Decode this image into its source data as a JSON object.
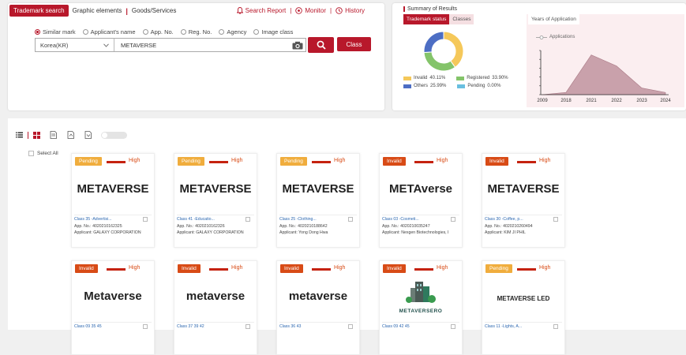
{
  "search": {
    "tabs": {
      "active": "Trademark search",
      "graphic": "Graphic elements",
      "goods": "Goods/Services"
    },
    "links": {
      "report": "Search Report",
      "monitor": "Monitor",
      "history": "History"
    },
    "options": [
      "Similar mark",
      "Applicant's name",
      "App. No.",
      "Reg. No.",
      "Agency",
      "Image class"
    ],
    "country": "Korea(KR)",
    "query": "METAVERSE",
    "class_btn": "Class"
  },
  "summary": {
    "title": "Summary of Results",
    "tabs": {
      "status": "Trademark status",
      "classes": "Classes"
    },
    "legend": [
      {
        "label": "Invalid",
        "pct": "40.11%",
        "color": "#f5c85a"
      },
      {
        "label": "Registered",
        "pct": "33.90%",
        "color": "#84c46a"
      },
      {
        "label": "Others",
        "pct": "25.99%",
        "color": "#4d6ec4"
      },
      {
        "label": "Pending",
        "pct": "0.00%",
        "color": "#69bfe0"
      }
    ],
    "yoa_label": "Years of Application",
    "series_name": "Applications",
    "years": [
      "2009",
      "2018",
      "2021",
      "2022",
      "2023",
      "2024"
    ]
  },
  "chart_data": [
    {
      "type": "pie",
      "categories": [
        "Invalid",
        "Registered",
        "Others",
        "Pending"
      ],
      "values": [
        40.11,
        33.9,
        25.99,
        0.0
      ]
    },
    {
      "type": "area",
      "series": [
        {
          "name": "Applications",
          "values": [
            0,
            1,
            18,
            13,
            3,
            1
          ]
        }
      ],
      "categories": [
        "2009",
        "2018",
        "2021",
        "2022",
        "2023",
        "2024"
      ],
      "ylim": [
        0,
        20
      ]
    }
  ],
  "results": {
    "select_all": "Select All",
    "similarity": "High",
    "cards": [
      {
        "status": "Pending",
        "mark": "METAVERSE",
        "cls": "Class 35 -Advertisi...",
        "app": "App. No.: 4020210162325",
        "applicant": "Applicant: GALAXY CORPORATION"
      },
      {
        "status": "Pending",
        "mark": "METAVERSE",
        "cls": "Class 41 -Educatio...",
        "app": "App. No.: 4020210162326",
        "applicant": "Applicant: GALAXY CORPORATION"
      },
      {
        "status": "Pending",
        "mark": "METAVERSE",
        "cls": "Class 25 -Clothing...",
        "app": "App. No.: 4020210188642",
        "applicant": "Applicant: Yong Dong Hwa"
      },
      {
        "status": "Invalid",
        "mark": "METAverse",
        "cls": "Class 03 -Cosmeti...",
        "app": "App. No.: 4020210035247",
        "applicant": "Applicant: Nexgen Biotechnologies, I"
      },
      {
        "status": "Invalid",
        "mark": "METAVERSE",
        "cls": "Class 30 -Coffee, p...",
        "app": "App. No.: 4020210260494",
        "applicant": "Applicant: KIM JI PHIL"
      },
      {
        "status": "Invalid",
        "mark": "Metaverse",
        "cls": "Class 09 35 45",
        "app": "",
        "applicant": ""
      },
      {
        "status": "Invalid",
        "mark": "metaverse",
        "cls": "Class 37 39 42",
        "app": "",
        "applicant": ""
      },
      {
        "status": "Invalid",
        "mark": "metaverse",
        "cls": "Class 36 43",
        "app": "",
        "applicant": ""
      },
      {
        "status": "Invalid",
        "mark": "METAVERSERO",
        "cls": "Class 09 42 45",
        "app": "",
        "applicant": ""
      },
      {
        "status": "Pending",
        "mark": "METAVERSE LED",
        "cls": "Class 11 -Lights, A...",
        "app": "",
        "applicant": ""
      }
    ]
  }
}
